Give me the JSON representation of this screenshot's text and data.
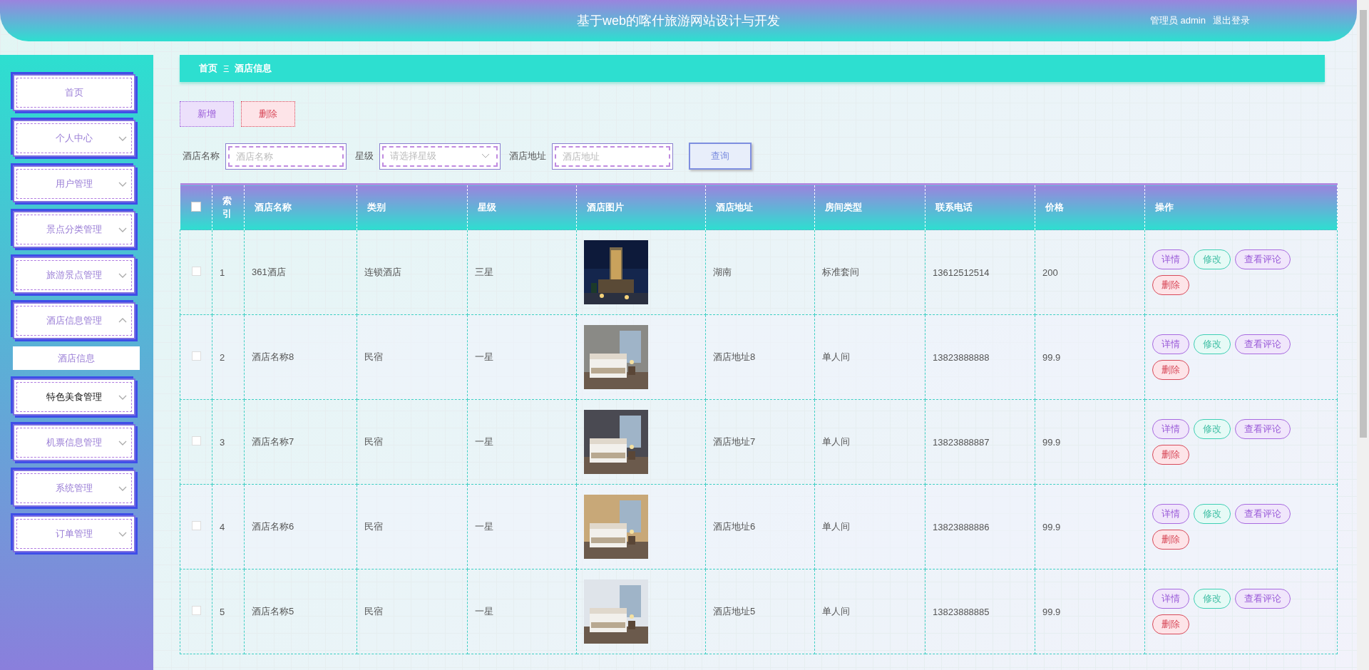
{
  "header": {
    "title": "基于web的喀什旅游网站设计与开发",
    "user": "管理员 admin",
    "logout": "退出登录"
  },
  "sidebar": {
    "items": [
      {
        "label": "首页",
        "kind": "link",
        "hovered": false
      },
      {
        "label": "个人中心",
        "kind": "menu",
        "expanded": false,
        "hovered": false
      },
      {
        "label": "用户管理",
        "kind": "menu",
        "expanded": false,
        "hovered": false
      },
      {
        "label": "景点分类管理",
        "kind": "menu",
        "expanded": false,
        "hovered": false
      },
      {
        "label": "旅游景点管理",
        "kind": "menu",
        "expanded": false,
        "hovered": false
      },
      {
        "label": "酒店信息管理",
        "kind": "menu",
        "expanded": true,
        "hovered": false,
        "children": [
          {
            "label": "酒店信息"
          }
        ]
      },
      {
        "label": "特色美食管理",
        "kind": "menu",
        "expanded": false,
        "hovered": true
      },
      {
        "label": "机票信息管理",
        "kind": "menu",
        "expanded": false,
        "hovered": false
      },
      {
        "label": "系统管理",
        "kind": "menu",
        "expanded": false,
        "hovered": false
      },
      {
        "label": "订单管理",
        "kind": "menu",
        "expanded": false,
        "hovered": false
      }
    ]
  },
  "breadcrumb": {
    "home": "首页",
    "separator": "Ξ",
    "current": "酒店信息"
  },
  "actions": {
    "add": "新增",
    "delete": "删除"
  },
  "search": [
    {
      "label": "酒店名称",
      "kind": "input",
      "placeholder": "酒店名称"
    },
    {
      "label": "星级",
      "kind": "select",
      "placeholder": "请选择星级"
    },
    {
      "label": "酒店地址",
      "kind": "input",
      "placeholder": "酒店地址"
    }
  ],
  "search_button": "查询",
  "table": {
    "select_all": false,
    "columns": [
      "索引",
      "酒店名称",
      "类别",
      "星级",
      "酒店图片",
      "酒店地址",
      "房间类型",
      "联系电话",
      "价格",
      "操作"
    ],
    "rows": [
      {
        "checked": false,
        "cells": [
          "1",
          "361酒店",
          "连锁酒店",
          "三星",
          "",
          "湖南",
          "标准套间",
          "13612512514",
          "200"
        ],
        "image": {
          "kind": "picture"
        },
        "buttons": [
          {
            "label": "详情",
            "kind": "detail"
          },
          {
            "label": "修改",
            "kind": "edit"
          },
          {
            "label": "查看评论",
            "kind": "comments"
          },
          {
            "label": "删除",
            "kind": "delete"
          }
        ]
      },
      {
        "checked": false,
        "cells": [
          "2",
          "酒店名称8",
          "民宿",
          "一星",
          "",
          "酒店地址8",
          "单人间",
          "13823888888",
          "99.9"
        ],
        "image": {
          "kind": "picture"
        },
        "buttons": [
          {
            "label": "详情",
            "kind": "detail"
          },
          {
            "label": "修改",
            "kind": "edit"
          },
          {
            "label": "查看评论",
            "kind": "comments"
          },
          {
            "label": "删除",
            "kind": "delete"
          }
        ]
      },
      {
        "checked": false,
        "cells": [
          "3",
          "酒店名称7",
          "民宿",
          "一星",
          "",
          "酒店地址7",
          "单人间",
          "13823888887",
          "99.9"
        ],
        "image": {
          "kind": "picture"
        },
        "buttons": [
          {
            "label": "详情",
            "kind": "detail"
          },
          {
            "label": "修改",
            "kind": "edit"
          },
          {
            "label": "查看评论",
            "kind": "comments"
          },
          {
            "label": "删除",
            "kind": "delete"
          }
        ]
      },
      {
        "checked": false,
        "cells": [
          "4",
          "酒店名称6",
          "民宿",
          "一星",
          "",
          "酒店地址6",
          "单人间",
          "13823888886",
          "99.9"
        ],
        "image": {
          "kind": "picture"
        },
        "buttons": [
          {
            "label": "详情",
            "kind": "detail"
          },
          {
            "label": "修改",
            "kind": "edit"
          },
          {
            "label": "查看评论",
            "kind": "comments"
          },
          {
            "label": "删除",
            "kind": "delete"
          }
        ]
      },
      {
        "checked": false,
        "cells": [
          "5",
          "酒店名称5",
          "民宿",
          "一星",
          "",
          "酒店地址5",
          "单人间",
          "13823888885",
          "99.9"
        ],
        "image": {
          "kind": "picture"
        },
        "buttons": [
          {
            "label": "详情",
            "kind": "detail"
          },
          {
            "label": "修改",
            "kind": "edit"
          },
          {
            "label": "查看评论",
            "kind": "comments"
          },
          {
            "label": "删除",
            "kind": "delete"
          }
        ]
      }
    ]
  }
}
